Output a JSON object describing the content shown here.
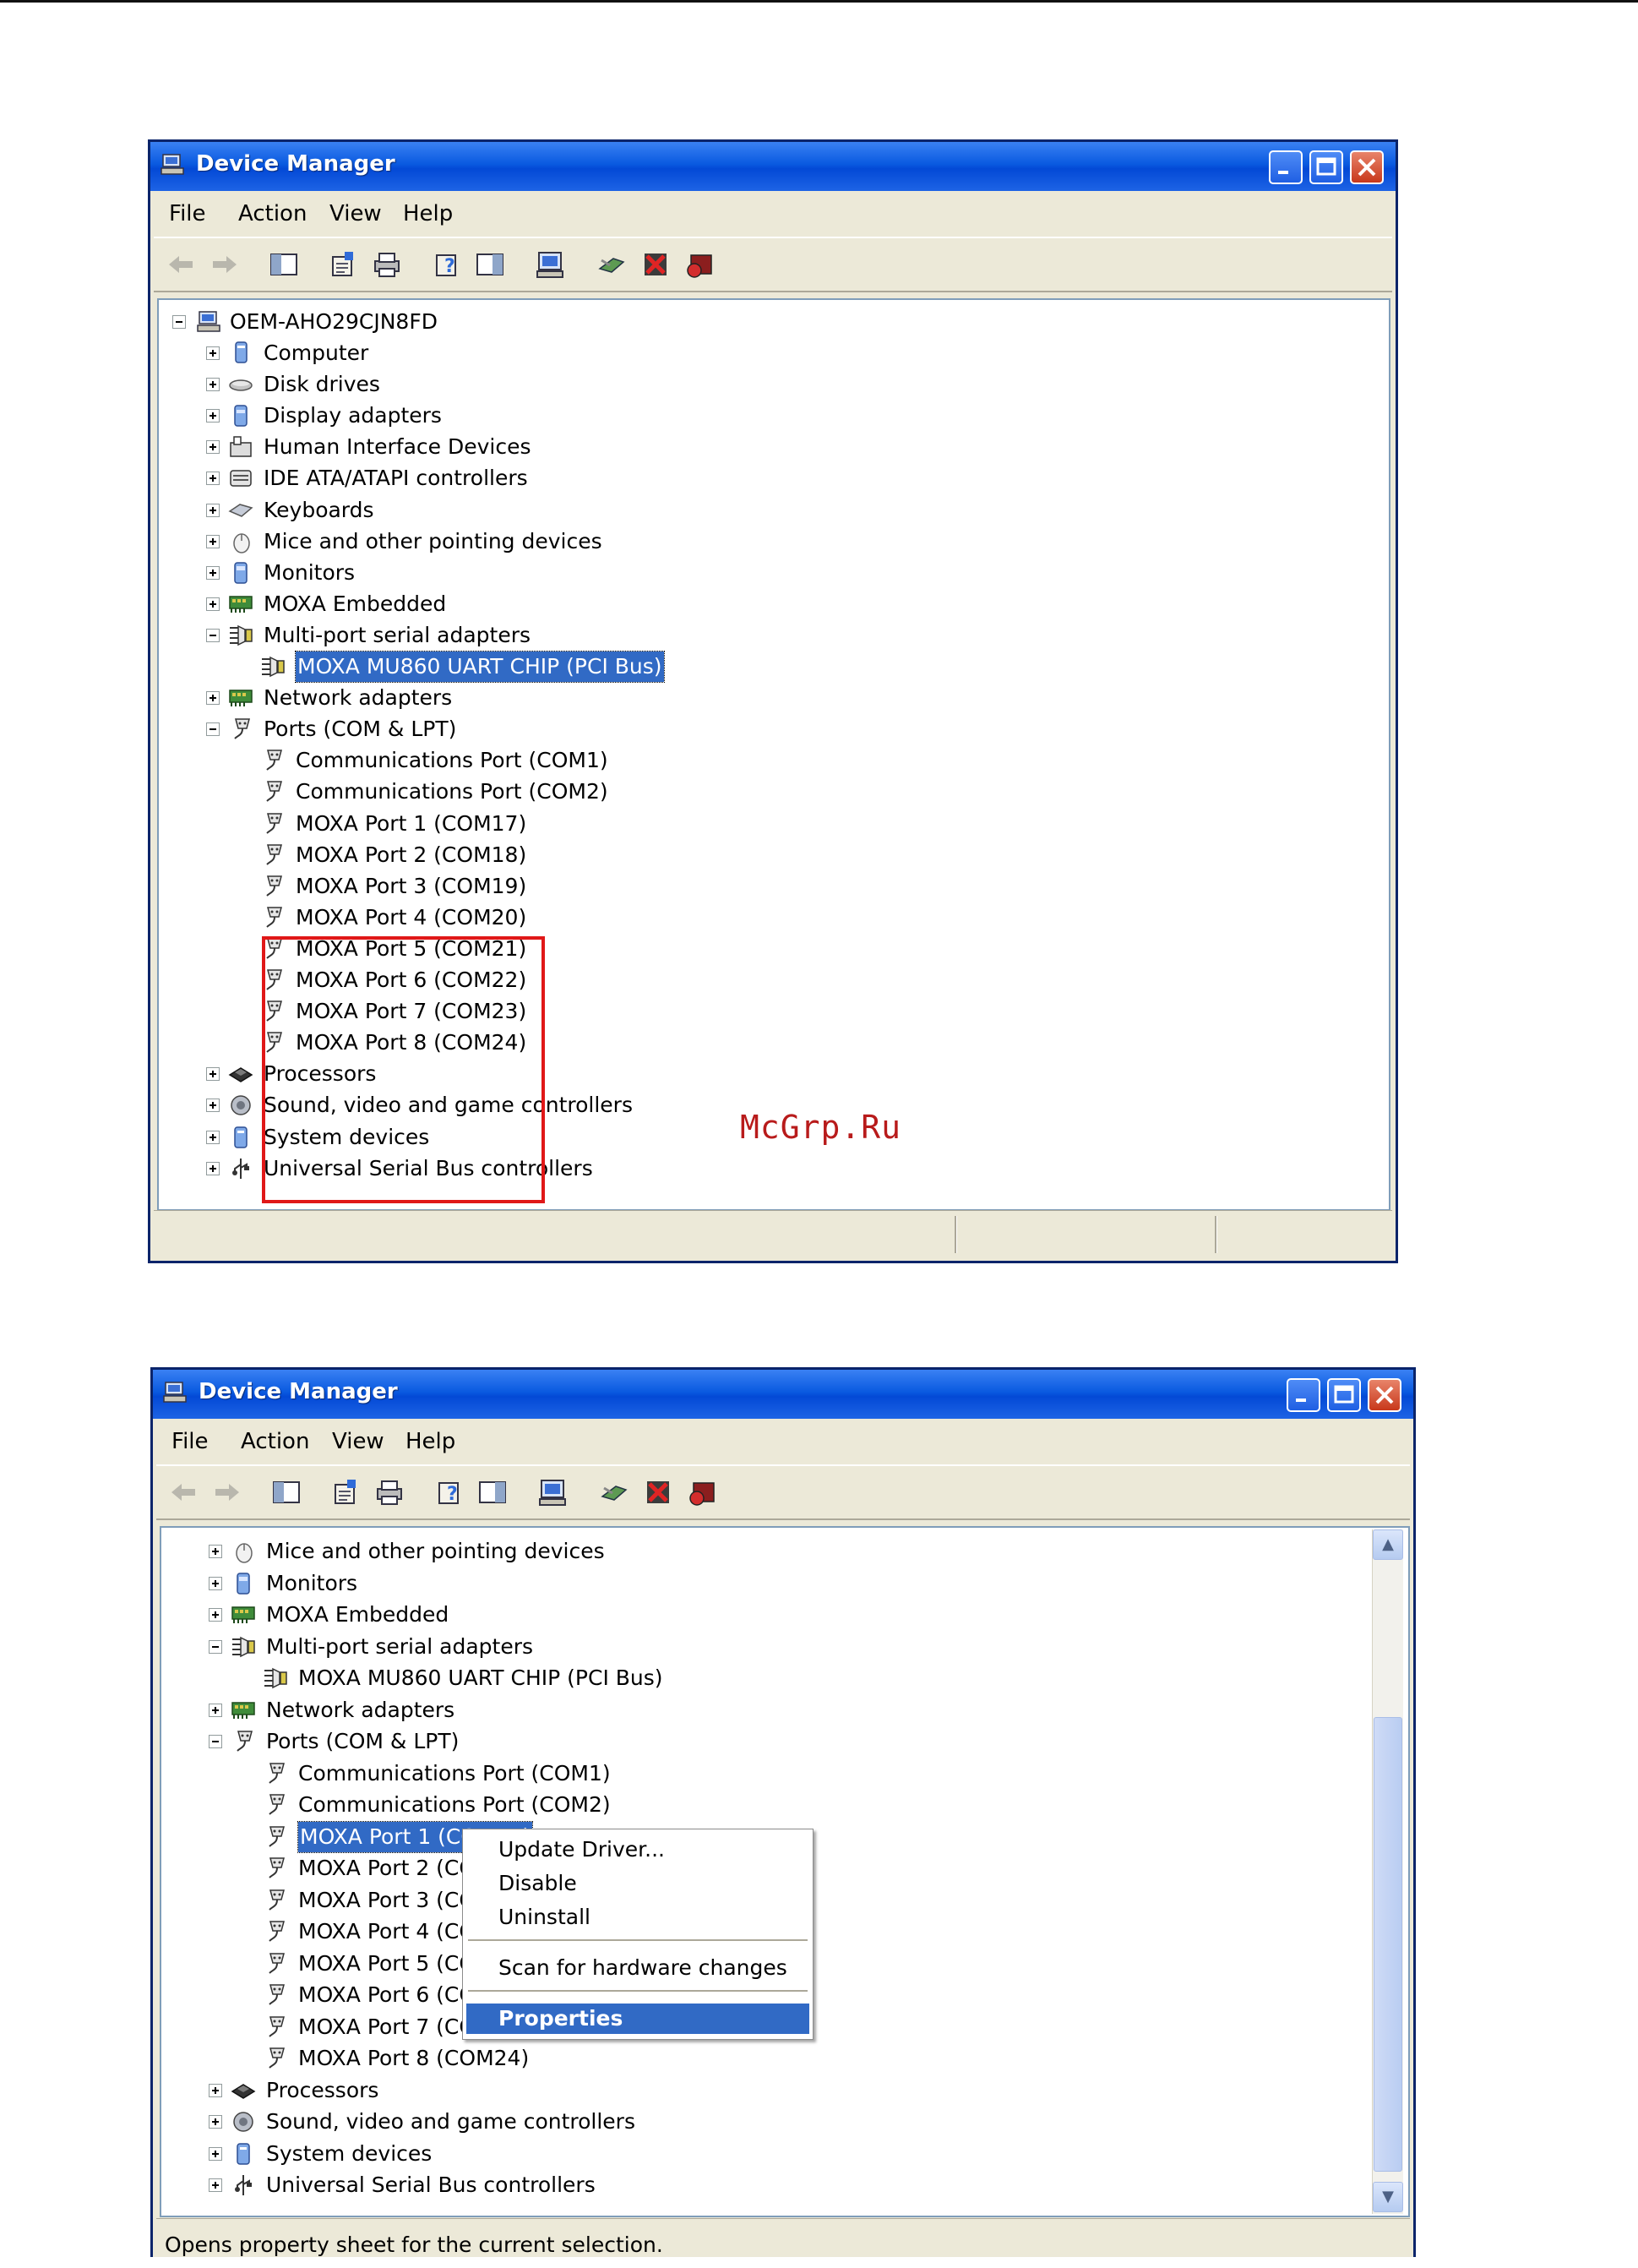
{
  "screenshot1": {
    "title": "Device Manager",
    "menu": [
      "File",
      "Action",
      "View",
      "Help"
    ],
    "root": "OEM-AHO29CJN8FD",
    "tree": [
      {
        "label": "Computer",
        "icon": "computer-icon",
        "level": 1,
        "expander": "plus"
      },
      {
        "label": "Disk drives",
        "icon": "disk-drive-icon",
        "level": 1,
        "expander": "plus"
      },
      {
        "label": "Display adapters",
        "icon": "display-adapter-icon",
        "level": 1,
        "expander": "plus"
      },
      {
        "label": "Human Interface Devices",
        "icon": "hid-icon",
        "level": 1,
        "expander": "plus"
      },
      {
        "label": "IDE ATA/ATAPI controllers",
        "icon": "ide-controller-icon",
        "level": 1,
        "expander": "plus"
      },
      {
        "label": "Keyboards",
        "icon": "keyboard-icon",
        "level": 1,
        "expander": "plus"
      },
      {
        "label": "Mice and other pointing devices",
        "icon": "mouse-icon",
        "level": 1,
        "expander": "plus"
      },
      {
        "label": "Monitors",
        "icon": "monitor-icon",
        "level": 1,
        "expander": "plus"
      },
      {
        "label": "MOXA Embedded",
        "icon": "network-card-icon",
        "level": 1,
        "expander": "plus"
      },
      {
        "label": "Multi-port serial adapters",
        "icon": "serial-adapter-icon",
        "level": 1,
        "expander": "minus"
      },
      {
        "label": "MOXA MU860 UART CHIP (PCI Bus)",
        "icon": "serial-adapter-icon",
        "level": 2,
        "expander": "none",
        "selected": true
      },
      {
        "label": "Network adapters",
        "icon": "network-card-icon",
        "level": 1,
        "expander": "plus"
      },
      {
        "label": "Ports (COM & LPT)",
        "icon": "port-icon",
        "level": 1,
        "expander": "minus"
      },
      {
        "label": "Communications Port (COM1)",
        "icon": "port-icon",
        "level": 2,
        "expander": "none"
      },
      {
        "label": "Communications Port (COM2)",
        "icon": "port-icon",
        "level": 2,
        "expander": "none"
      },
      {
        "label": "MOXA Port 1 (COM17)",
        "icon": "port-icon",
        "level": 2,
        "expander": "none"
      },
      {
        "label": "MOXA Port 2 (COM18)",
        "icon": "port-icon",
        "level": 2,
        "expander": "none"
      },
      {
        "label": "MOXA Port 3 (COM19)",
        "icon": "port-icon",
        "level": 2,
        "expander": "none"
      },
      {
        "label": "MOXA Port 4 (COM20)",
        "icon": "port-icon",
        "level": 2,
        "expander": "none"
      },
      {
        "label": "MOXA Port 5 (COM21)",
        "icon": "port-icon",
        "level": 2,
        "expander": "none"
      },
      {
        "label": "MOXA Port 6 (COM22)",
        "icon": "port-icon",
        "level": 2,
        "expander": "none"
      },
      {
        "label": "MOXA Port 7 (COM23)",
        "icon": "port-icon",
        "level": 2,
        "expander": "none"
      },
      {
        "label": "MOXA Port 8 (COM24)",
        "icon": "port-icon",
        "level": 2,
        "expander": "none"
      },
      {
        "label": "Processors",
        "icon": "processor-icon",
        "level": 1,
        "expander": "plus"
      },
      {
        "label": "Sound, video and game controllers",
        "icon": "sound-icon",
        "level": 1,
        "expander": "plus"
      },
      {
        "label": "System devices",
        "icon": "system-device-icon",
        "level": 1,
        "expander": "plus"
      },
      {
        "label": "Universal Serial Bus controllers",
        "icon": "usb-icon",
        "level": 1,
        "expander": "plus"
      }
    ],
    "status": ""
  },
  "screenshot2": {
    "title": "Device Manager",
    "menu": [
      "File",
      "Action",
      "View",
      "Help"
    ],
    "tree": [
      {
        "label": "Mice and other pointing devices",
        "icon": "mouse-icon",
        "level": 1,
        "expander": "plus"
      },
      {
        "label": "Monitors",
        "icon": "monitor-icon",
        "level": 1,
        "expander": "plus"
      },
      {
        "label": "MOXA Embedded",
        "icon": "network-card-icon",
        "level": 1,
        "expander": "plus"
      },
      {
        "label": "Multi-port serial adapters",
        "icon": "serial-adapter-icon",
        "level": 1,
        "expander": "minus"
      },
      {
        "label": "MOXA MU860 UART CHIP (PCI Bus)",
        "icon": "serial-adapter-icon",
        "level": 2,
        "expander": "none"
      },
      {
        "label": "Network adapters",
        "icon": "network-card-icon",
        "level": 1,
        "expander": "plus"
      },
      {
        "label": "Ports (COM & LPT)",
        "icon": "port-icon",
        "level": 1,
        "expander": "minus"
      },
      {
        "label": "Communications Port (COM1)",
        "icon": "port-icon",
        "level": 2,
        "expander": "none"
      },
      {
        "label": "Communications Port (COM2)",
        "icon": "port-icon",
        "level": 2,
        "expander": "none"
      },
      {
        "label": "MOXA Port 1 (COM17)",
        "icon": "port-icon",
        "level": 2,
        "expander": "none",
        "selected": true
      },
      {
        "label": "MOXA Port 2 (COM18)",
        "icon": "port-icon",
        "level": 2,
        "expander": "none"
      },
      {
        "label": "MOXA Port 3 (COM19)",
        "icon": "port-icon",
        "level": 2,
        "expander": "none"
      },
      {
        "label": "MOXA Port 4 (COM20)",
        "icon": "port-icon",
        "level": 2,
        "expander": "none"
      },
      {
        "label": "MOXA Port 5 (COM21)",
        "icon": "port-icon",
        "level": 2,
        "expander": "none"
      },
      {
        "label": "MOXA Port 6 (COM22)",
        "icon": "port-icon",
        "level": 2,
        "expander": "none"
      },
      {
        "label": "MOXA Port 7 (COM23)",
        "icon": "port-icon",
        "level": 2,
        "expander": "none"
      },
      {
        "label": "MOXA Port 8 (COM24)",
        "icon": "port-icon",
        "level": 2,
        "expander": "none"
      },
      {
        "label": "Processors",
        "icon": "processor-icon",
        "level": 1,
        "expander": "plus"
      },
      {
        "label": "Sound, video and game controllers",
        "icon": "sound-icon",
        "level": 1,
        "expander": "plus"
      },
      {
        "label": "System devices",
        "icon": "system-device-icon",
        "level": 1,
        "expander": "plus"
      },
      {
        "label": "Universal Serial Bus controllers",
        "icon": "usb-icon",
        "level": 1,
        "expander": "plus"
      }
    ],
    "context_menu": {
      "items": [
        "Update Driver...",
        "Disable",
        "Uninstall",
        "Scan for hardware changes",
        "Properties"
      ],
      "active": "Properties"
    },
    "status": "Opens property sheet for the current selection."
  },
  "watermark": "McGrp.Ru",
  "colors": {
    "titlebar": "#0a5ae0",
    "selection": "#316ac5",
    "highlight_box": "#e01818",
    "watermark": "#b81b1b"
  }
}
